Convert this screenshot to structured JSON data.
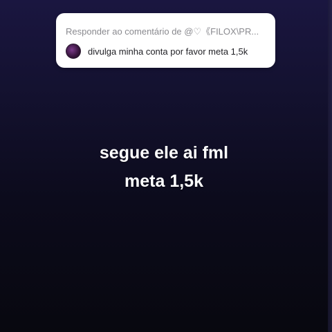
{
  "reply_card": {
    "header": "Responder ao comentário de @♡《FILOX\\PR...",
    "comment": "divulga minha conta por favor meta 1,5k"
  },
  "caption": {
    "line1": "segue ele ai fml",
    "line2": "meta 1,5k"
  },
  "colors": {
    "background_top": "#1a1640",
    "background_bottom": "#08080f",
    "card_background": "#ffffff",
    "caption_text": "#ffffff"
  }
}
